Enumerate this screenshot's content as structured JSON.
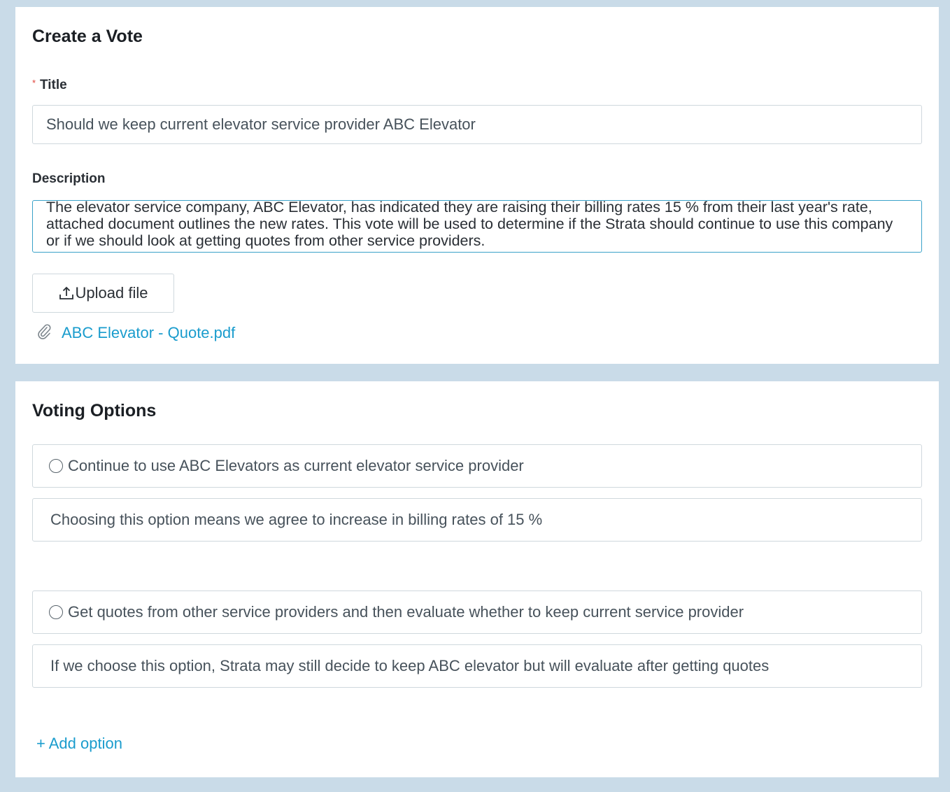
{
  "create_vote": {
    "heading": "Create a Vote",
    "title_label": "Title",
    "required_marker": "*",
    "title_value": "Should we keep current elevator service provider ABC Elevator",
    "description_label": "Description",
    "description_value": "The elevator service company, ABC Elevator, has indicated they are raising their billing rates 15 % from their last year's rate, attached document outlines the new rates.  This vote will be used to determine if the Strata should continue to use this company or if we should look at getting quotes from other service providers.",
    "upload_label": "Upload file",
    "attachment_name": "ABC Elevator - Quote.pdf"
  },
  "voting_options": {
    "heading": "Voting Options",
    "options": [
      {
        "label": "Continue to use ABC Elevators as current elevator service provider",
        "description": "Choosing this option means we agree to increase in billing rates of 15 %"
      },
      {
        "label": "Get quotes from other service providers and then evaluate whether to keep current service provider",
        "description": "If we choose this option, Strata may still decide to keep ABC elevator but will evaluate after getting quotes"
      }
    ],
    "add_option_label": "+ Add option"
  },
  "colors": {
    "background": "#c9dbe8",
    "link": "#1a9ccd",
    "required": "#e0453d",
    "focus_border": "#3aa2c9"
  },
  "icons": {
    "upload": "upload-icon",
    "attachment": "paperclip-icon",
    "radio": "radio-unchecked-icon"
  }
}
